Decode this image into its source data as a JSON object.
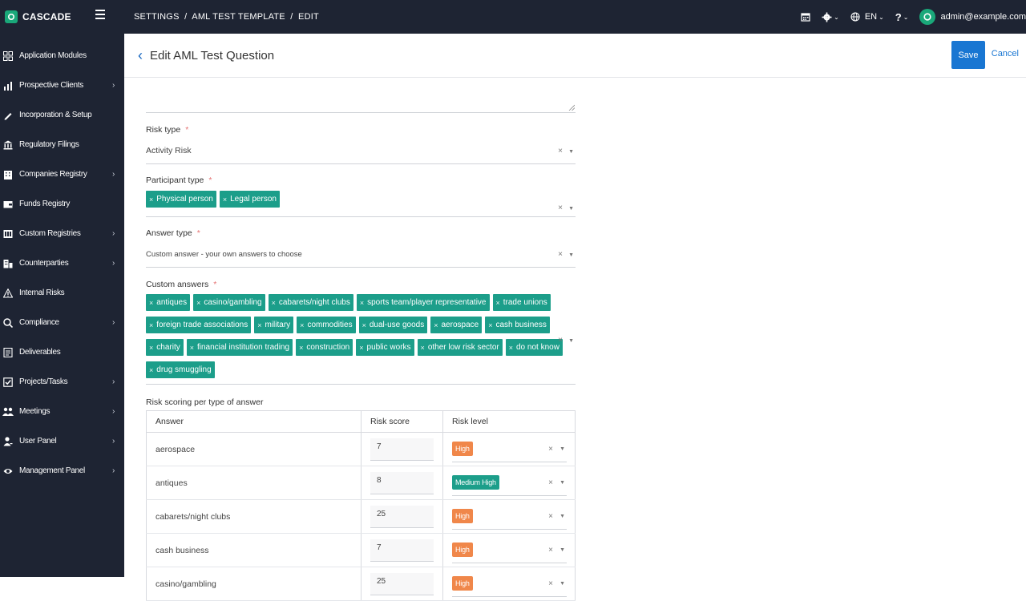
{
  "app": {
    "name": "CASCADE"
  },
  "breadcrumb": "SETTINGS  /  AML TEST TEMPLATE  /  EDIT",
  "topbar": {
    "lang": "EN",
    "help": "?",
    "user_email": "admin@example.com"
  },
  "sidebar": {
    "items": [
      {
        "label": "Application Modules",
        "icon": "grid-icon",
        "arrow": false
      },
      {
        "label": "Prospective Clients",
        "icon": "chart-icon",
        "arrow": true
      },
      {
        "label": "Incorporation & Setup",
        "icon": "pen-icon",
        "arrow": false
      },
      {
        "label": "Regulatory Filings",
        "icon": "bank-icon",
        "arrow": false
      },
      {
        "label": "Companies Registry",
        "icon": "building-icon",
        "arrow": true
      },
      {
        "label": "Funds Registry",
        "icon": "wallet-icon",
        "arrow": false
      },
      {
        "label": "Custom Registries",
        "icon": "registry-icon",
        "arrow": true
      },
      {
        "label": "Counterparties",
        "icon": "counterparty-icon",
        "arrow": true
      },
      {
        "label": "Internal Risks",
        "icon": "warning-icon",
        "arrow": false
      },
      {
        "label": "Compliance",
        "icon": "search-icon",
        "arrow": true
      },
      {
        "label": "Deliverables",
        "icon": "document-icon",
        "arrow": false
      },
      {
        "label": "Projects/Tasks",
        "icon": "checkbox-icon",
        "arrow": true
      },
      {
        "label": "Meetings",
        "icon": "people-icon",
        "arrow": true
      },
      {
        "label": "User Panel",
        "icon": "user-icon",
        "arrow": true
      },
      {
        "label": "Management Panel",
        "icon": "eye-icon",
        "arrow": true
      }
    ]
  },
  "header": {
    "title": "Edit AML Test Question",
    "save": "Save",
    "cancel": "Cancel"
  },
  "form": {
    "risk_type": {
      "label": "Risk type",
      "required": "*",
      "value": "Activity Risk"
    },
    "participant_type": {
      "label": "Participant type",
      "required": "*",
      "tags": [
        "Physical person",
        "Legal person"
      ]
    },
    "answer_type": {
      "label": "Answer type",
      "required": "*",
      "value": "Custom answer - your own answers to choose"
    },
    "custom_answers": {
      "label": "Custom answers",
      "required": "*",
      "rows": [
        [
          "antiques",
          "casino/gambling",
          "cabarets/night clubs",
          "sports team/player representative",
          "trade unions"
        ],
        [
          "foreign trade associations",
          "military",
          "commodities",
          "dual-use goods",
          "aerospace",
          "cash business"
        ],
        [
          "charity",
          "financial institution trading",
          "construction",
          "public works",
          "other low risk sector",
          "do not know"
        ],
        [
          "drug smuggling"
        ]
      ]
    },
    "scoring": {
      "label": "Risk scoring per type of answer",
      "headers": {
        "answer": "Answer",
        "score": "Risk score",
        "level": "Risk level"
      },
      "rows": [
        {
          "answer": "aerospace",
          "score": "7",
          "level": "High",
          "color": "#f0874a"
        },
        {
          "answer": "antiques",
          "score": "8",
          "level": "Medium High",
          "color": "#1c9e8a"
        },
        {
          "answer": "cabarets/night clubs",
          "score": "25",
          "level": "High",
          "color": "#f0874a"
        },
        {
          "answer": "cash business",
          "score": "7",
          "level": "High",
          "color": "#f0874a"
        },
        {
          "answer": "casino/gambling",
          "score": "25",
          "level": "High",
          "color": "#f0874a"
        }
      ]
    }
  },
  "symbols": {
    "clear": "×",
    "dropdown": "▼",
    "back": "‹",
    "arrow": "›",
    "tag_x": "×"
  },
  "colors": {
    "brand": "#1e2433",
    "accent": "#1976d2",
    "tag": "#1c9e8a",
    "high": "#f0874a"
  }
}
